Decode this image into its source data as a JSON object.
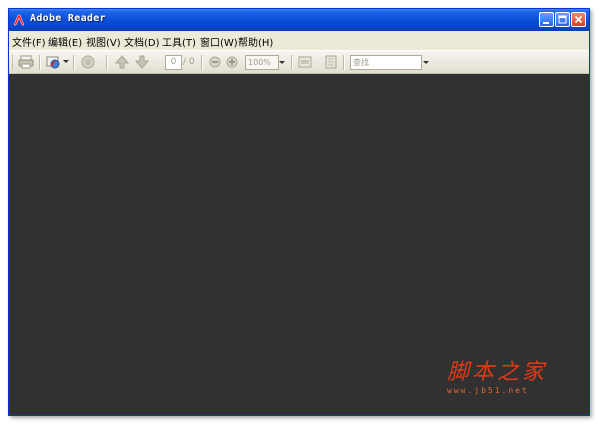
{
  "window": {
    "title": "Adobe Reader",
    "accent_color": "#0a4fd8",
    "document_background": "#323131"
  },
  "menu": [
    {
      "label": "文件(F)"
    },
    {
      "label": "编辑(E)"
    },
    {
      "label": "视图(V)"
    },
    {
      "label": "文档(D)"
    },
    {
      "label": "工具(T)"
    },
    {
      "label": "窗口(W)"
    },
    {
      "label": "帮助(H)"
    }
  ],
  "toolbar": {
    "page_current": "0",
    "page_total": "/ 0",
    "zoom_value": "100%",
    "find_placeholder": "查找",
    "icons": [
      "print-icon",
      "email-icon",
      "hand-icon",
      "previous-page-icon",
      "next-page-icon",
      "zoom-out-icon",
      "zoom-in-icon",
      "fit-page-icon",
      "fit-width-icon"
    ]
  },
  "watermark": {
    "title": "脚本之家",
    "url": "www.jb51.net",
    "color": "#e03a14"
  }
}
